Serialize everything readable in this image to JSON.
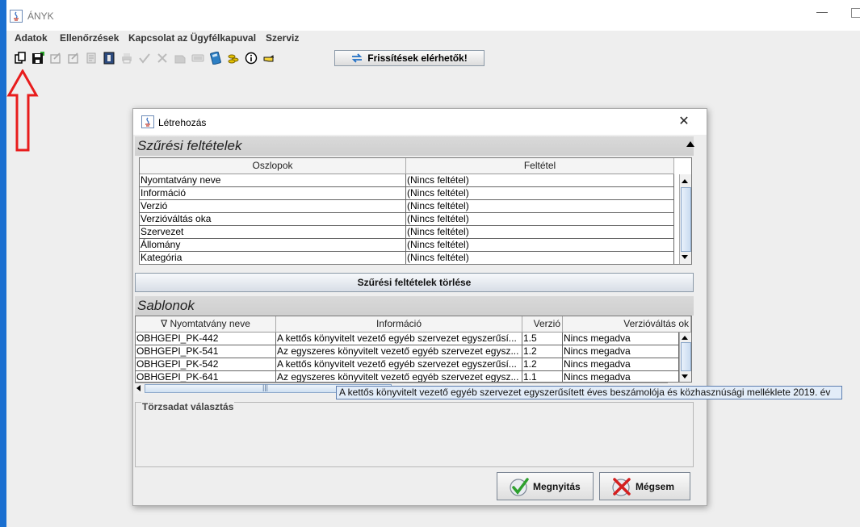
{
  "window": {
    "title": "ÁNYK"
  },
  "menu": [
    "Adatok",
    "Ellenőrzések",
    "Kapcsolat az Ügyfélkapuval",
    "Szerviz"
  ],
  "toolbar": {
    "icons": [
      "copy-icon",
      "save-icon",
      "edit-icon",
      "edit-icon",
      "document-icon",
      "book-icon",
      "print-icon",
      "check-icon",
      "cross-icon",
      "attach-icon",
      "keyboard-icon",
      "calculator-icon",
      "coins-icon",
      "info-icon",
      "hand-pointer-icon"
    ],
    "update_label": "Frissítések elérhetők!"
  },
  "dialog": {
    "title": "Létrehozás",
    "filter_section": {
      "title": "Szűrési feltételek",
      "headers": [
        "Oszlopok",
        "Feltétel"
      ],
      "rows": [
        [
          "Nyomtatvány neve",
          "(Nincs feltétel)"
        ],
        [
          "Információ",
          "(Nincs feltétel)"
        ],
        [
          "Verzió",
          "(Nincs feltétel)"
        ],
        [
          "Verzióváltás oka",
          "(Nincs feltétel)"
        ],
        [
          "Szervezet",
          "(Nincs feltétel)"
        ],
        [
          "Állomány",
          "(Nincs feltétel)"
        ],
        [
          "Kategória",
          "(Nincs feltétel)"
        ]
      ],
      "clear_button": "Szűrési feltételek törlése"
    },
    "templates_section": {
      "title": "Sablonok",
      "headers": [
        "∇ Nyomtatvány neve",
        "Információ",
        "Verzió",
        "Verzióváltás ok"
      ],
      "rows": [
        [
          "OBHGEPI_PK-442",
          "A kettős könyvitelt vezető egyéb szervezet egyszerűsí...",
          "1.5",
          "Nincs megadva"
        ],
        [
          "OBHGEPI_PK-541",
          "Az egyszeres könyvitelt vezető egyéb szervezet egysz...",
          "1.2",
          "Nincs megadva"
        ],
        [
          "OBHGEPI_PK-542",
          "A kettős könyvitelt vezető egyéb szervezet egyszerűsí...",
          "1.2",
          "Nincs megadva"
        ],
        [
          "OBHGEPI_PK-641",
          "Az egyszeres könyvitelt vezető egyéb szervezet egysz...",
          "1.1",
          "Nincs megadva"
        ]
      ],
      "scroll_grip": "|||"
    },
    "master_data": {
      "label": "Törzsadat választás"
    },
    "open_button": "Megnyitás",
    "cancel_button": "Mégsem"
  },
  "tooltip": "A kettős könyvitelt vezető egyéb szervezet egyszerűsített éves beszámolója és közhasznúsági melléklete 2019. év",
  "colors": {
    "desktop": "#1a6fd0",
    "arrow": "#e81c1c",
    "tooltip_bg": "#e2ecf8"
  }
}
